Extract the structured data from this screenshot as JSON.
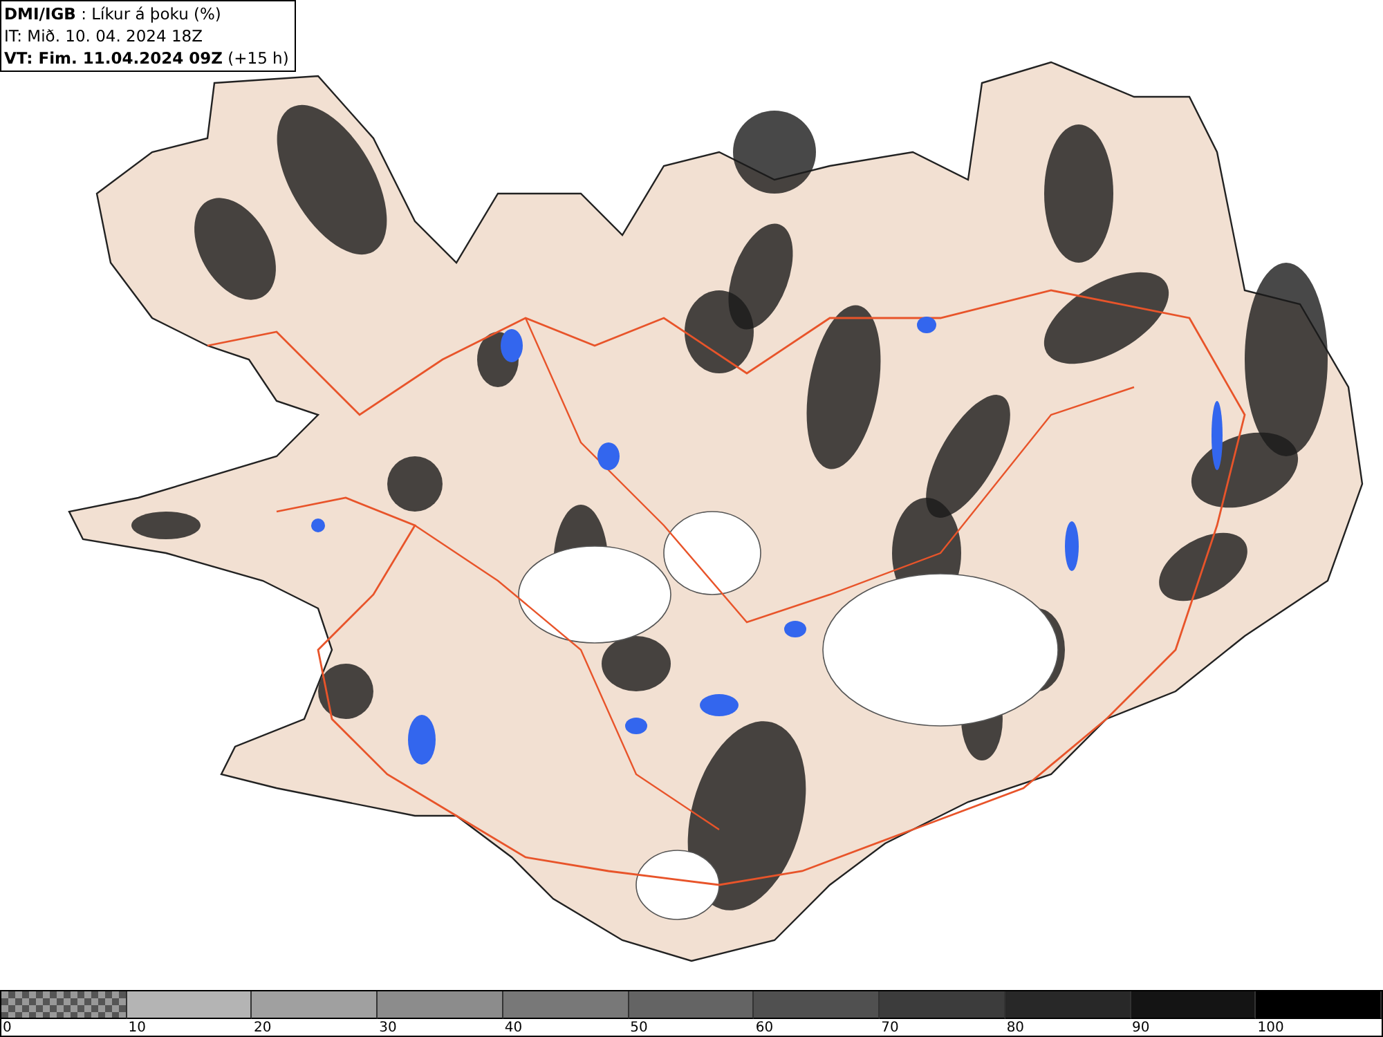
{
  "header": {
    "lines": [
      "**DMI/IGB** : Líkur á þoku (%)",
      "IT: Mið. 10. 04. 2024 18Z",
      "**VT: Fim. 11.04.2024 09Z** (+15 h)"
    ]
  },
  "legend": {
    "bins": [
      {
        "kind": "checker"
      },
      {
        "kind": "solid",
        "color": "#b4b4b4"
      },
      {
        "kind": "solid",
        "color": "#a0a0a0"
      },
      {
        "kind": "solid",
        "color": "#8c8c8c"
      },
      {
        "kind": "solid",
        "color": "#787878"
      },
      {
        "kind": "solid",
        "color": "#646464"
      },
      {
        "kind": "solid",
        "color": "#505050"
      },
      {
        "kind": "solid",
        "color": "#3c3c3c"
      },
      {
        "kind": "solid",
        "color": "#282828"
      },
      {
        "kind": "solid",
        "color": "#141414"
      },
      {
        "kind": "solid",
        "color": "#000000"
      }
    ],
    "labels": [
      "0",
      "10",
      "20",
      "30",
      "40",
      "50",
      "60",
      "70",
      "80",
      "90",
      "100"
    ]
  }
}
